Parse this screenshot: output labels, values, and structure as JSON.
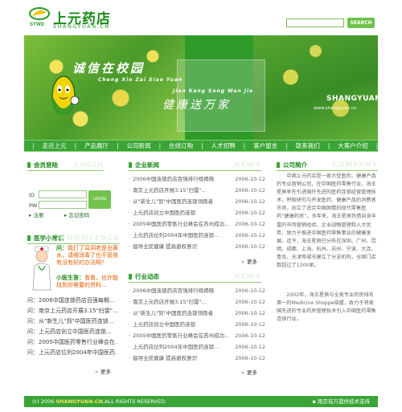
{
  "header": {
    "brand_cn": "上元药店",
    "brand_en": "SHANGYUAN.CN",
    "logo_text": "SYWD",
    "search_label": "SEARCH"
  },
  "banner": {
    "slogan1": "诚信在校园",
    "slogan1_en": "Cheng Xin Zai Xiao Yuan",
    "slogan2": "健康送万家",
    "slogan2_en": "Jian Kang Song Wan Jia",
    "brand": "SHANGYUAN",
    "url": "www.shangyuan.cn"
  },
  "nav": {
    "items": [
      "走近上元",
      "产品展厅",
      "公司新闻",
      "在线订购",
      "人才招聘",
      "客户留言",
      "联系我们",
      "大客户介绍"
    ]
  },
  "member": {
    "title": "会员登陆",
    "ghost": "LOGIN",
    "id_label": "ID",
    "pw_label": "PW",
    "login_label": "LOGIN",
    "register": "注册",
    "forgot": "忘记密码"
  },
  "knowledge": {
    "title": "医学小常识",
    "ghost": "KNOWLEDGE",
    "q": "问：我打了耳洞老是出黄水，请哪消毒了也不管用有没有好的办法啊？",
    "a": "小医生答：看看，也许能找到你需要的资料...",
    "q_prefix": "问：",
    "a_prefix": "小医生答：",
    "q_text": "我打了耳洞老是出黄水，请哪消毒了也不管用有没有好的办法啊？",
    "a_text": "看看，也许能找到你需要的资料...",
    "list": [
      "问：2006中国连锁药店百强每期...",
      "问：南京上元药店开展3.15\"扫雷\"...",
      "问：从\"新生儿\"到\"中国医药连锁...",
      "问：上元药店创立中国医药连锁...",
      "问：2005中国医药零售行业峰会在...",
      "问：上元药店位列2004年中国医药..."
    ],
    "more": "更多"
  },
  "enterprise": {
    "title": "企业新闻",
    "ghost": "NEWS",
    "items": [
      {
        "title": "2006中国连锁药店百强排行榜揭晓",
        "date": "2006-10-12"
      },
      {
        "title": "南京上元药店开展3.15\"扫雷\"...",
        "date": "2006-10-12"
      },
      {
        "title": "从\"新生儿\"到\"中国医药连锁领跑者",
        "date": "2006-10-12"
      },
      {
        "title": "上元药店创立中国医药连锁",
        "date": "2006-10-12"
      },
      {
        "title": "2005中国医药零售行业峰会在苏州成功...",
        "date": "2006-10-12"
      },
      {
        "title": "上元药店位列2004年中国医药连锁...",
        "date": "2006-10-12"
      },
      {
        "title": "倡导全民健康  提高避权意识",
        "date": "2006-10-12"
      }
    ],
    "more": "更多"
  },
  "industry": {
    "title": "行业动态",
    "ghost": "NEWS",
    "items": [
      {
        "title": "2006中国连锁药店百强排行榜揭晓",
        "date": "2006-10-12"
      },
      {
        "title": "南京上元药店开展3.15\"扫雷\"...",
        "date": "2006-10-12"
      },
      {
        "title": "从\"新生儿\"到\"中国医药连锁领跑者",
        "date": "2006-10-12"
      },
      {
        "title": "上元药店创立中国医药连锁",
        "date": "2006-10-12"
      },
      {
        "title": "2005中国医药零售行业峰会在苏州成功...",
        "date": "2006-10-12"
      },
      {
        "title": "上元药店位列2004年中国医药连锁...",
        "date": "2006-10-12"
      },
      {
        "title": "倡导全民健康  提高避权意识",
        "date": "2006-10-12"
      }
    ],
    "more": "更多"
  },
  "intro": {
    "title": "公司简介",
    "ghost": "COMPANY",
    "p1": "中国上元药店是一家大型医药、健康产品的专业营销公司，在中国医药零售行业，海王星辰率先引进国外先进的医药连锁经营管理技术，积极研究与开发医药、健康产品的消费者市场，创立了适合中国国情的现代零售医药“健康药房”。多年来，海王星辰凭借自身丰富的市场营销经验、企业战略管理和人才优势，致力于推进中国医药零售事业的健康发展。迄今，海王星辰已分布在深圳、广州、昆明、成都、上海、杭州、苏州、宁波、大连、青岛、天津等城市建立了分支机构，全国门店数超过了1300家。",
    "p2": "2002年，海王星辰与全美专业药房排名第一的Medicine Shoppe结盟，致力于将美国先进的专业药房管理技术引入中国医药零售连锁行业。"
  },
  "footer": {
    "copyright_prefix": "(c) 2006",
    "copyright_brand": "SHANGYUAN.CN",
    "copyright_suffix": ",ALL RIGHTS RESERVED.",
    "credit": "南京铭万提供技术支持"
  },
  "colors": {
    "primary": "#3aa536",
    "dark": "#1a8a1a",
    "accent": "#e85d00"
  }
}
